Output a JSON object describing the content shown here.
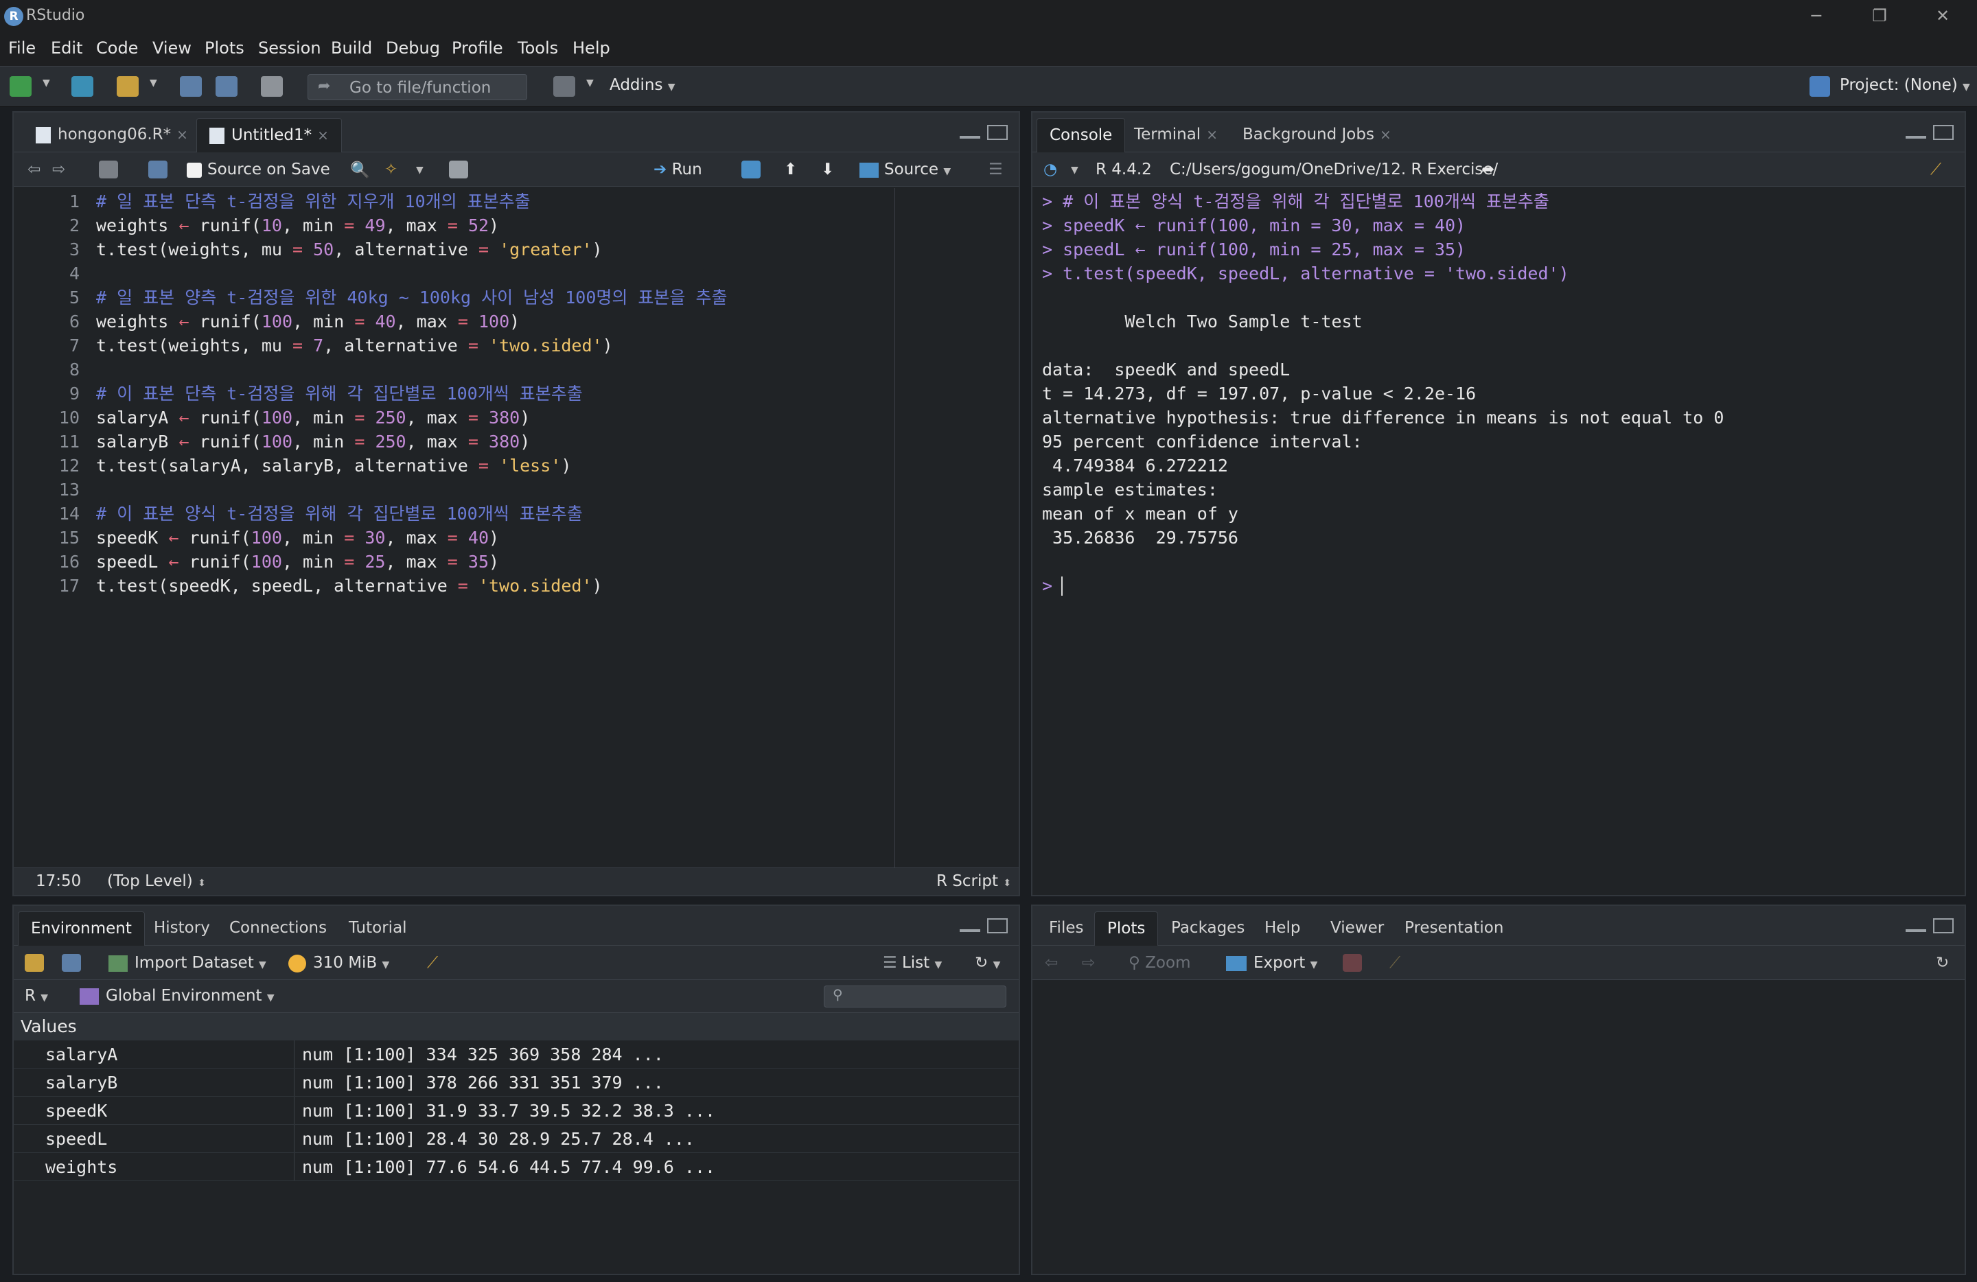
{
  "app": {
    "logo_letter": "R",
    "title": "RStudio"
  },
  "window_controls": {
    "minimize": "─",
    "restore": "❐",
    "close": "✕"
  },
  "menu": [
    "File",
    "Edit",
    "Code",
    "View",
    "Plots",
    "Session",
    "Build",
    "Debug",
    "Profile",
    "Tools",
    "Help"
  ],
  "toolbar": {
    "goto_placeholder": "Go to file/function",
    "addins_label": "Addins",
    "project_label": "Project: (None)"
  },
  "source_pane": {
    "tabs": [
      {
        "label": "hongong06.R*",
        "close": "×"
      },
      {
        "label": "Untitled1*",
        "close": "×"
      }
    ],
    "source_on_save_label": "Source on Save",
    "run_label": "Run",
    "source_label": "Source",
    "code_lines": [
      {
        "n": "1",
        "tokens": [
          [
            "c",
            "# 일 표본 단측 t-검정을 위한 지우개 10개의 표본추출"
          ]
        ]
      },
      {
        "n": "2",
        "tokens": [
          [
            "p",
            "weights "
          ],
          [
            "o",
            "←"
          ],
          [
            "p",
            " runif("
          ],
          [
            "d",
            "10"
          ],
          [
            "p",
            ", min "
          ],
          [
            "o",
            "="
          ],
          [
            "p",
            " "
          ],
          [
            "d",
            "49"
          ],
          [
            "p",
            ", max "
          ],
          [
            "o",
            "="
          ],
          [
            "p",
            " "
          ],
          [
            "d",
            "52"
          ],
          [
            "p",
            ")"
          ]
        ]
      },
      {
        "n": "3",
        "tokens": [
          [
            "p",
            "t.test(weights, mu "
          ],
          [
            "o",
            "="
          ],
          [
            "p",
            " "
          ],
          [
            "d",
            "50"
          ],
          [
            "p",
            ", alternative "
          ],
          [
            "o",
            "="
          ],
          [
            "p",
            " "
          ],
          [
            "s",
            "'greater'"
          ],
          [
            "p",
            ")"
          ]
        ]
      },
      {
        "n": "4",
        "tokens": []
      },
      {
        "n": "5",
        "tokens": [
          [
            "c",
            "# 일 표본 양측 t-검정을 위한 40kg ~ 100kg 사이 남성 100명의 표본을 추출"
          ]
        ]
      },
      {
        "n": "6",
        "tokens": [
          [
            "p",
            "weights "
          ],
          [
            "o",
            "←"
          ],
          [
            "p",
            " runif("
          ],
          [
            "d",
            "100"
          ],
          [
            "p",
            ", min "
          ],
          [
            "o",
            "="
          ],
          [
            "p",
            " "
          ],
          [
            "d",
            "40"
          ],
          [
            "p",
            ", max "
          ],
          [
            "o",
            "="
          ],
          [
            "p",
            " "
          ],
          [
            "d",
            "100"
          ],
          [
            "p",
            ")"
          ]
        ]
      },
      {
        "n": "7",
        "tokens": [
          [
            "p",
            "t.test(weights, mu "
          ],
          [
            "o",
            "="
          ],
          [
            "p",
            " "
          ],
          [
            "d",
            "7"
          ],
          [
            "p",
            ", alternative "
          ],
          [
            "o",
            "="
          ],
          [
            "p",
            " "
          ],
          [
            "s",
            "'two.sided'"
          ],
          [
            "p",
            ")"
          ]
        ]
      },
      {
        "n": "8",
        "tokens": []
      },
      {
        "n": "9",
        "tokens": [
          [
            "c",
            "# 이 표본 단측 t-검정을 위해 각 집단별로 100개씩 표본추출"
          ]
        ]
      },
      {
        "n": "10",
        "tokens": [
          [
            "p",
            "salaryA "
          ],
          [
            "o",
            "←"
          ],
          [
            "p",
            " runif("
          ],
          [
            "d",
            "100"
          ],
          [
            "p",
            ", min "
          ],
          [
            "o",
            "="
          ],
          [
            "p",
            " "
          ],
          [
            "d",
            "250"
          ],
          [
            "p",
            ", max "
          ],
          [
            "o",
            "="
          ],
          [
            "p",
            " "
          ],
          [
            "d",
            "380"
          ],
          [
            "p",
            ")"
          ]
        ]
      },
      {
        "n": "11",
        "tokens": [
          [
            "p",
            "salaryB "
          ],
          [
            "o",
            "←"
          ],
          [
            "p",
            " runif("
          ],
          [
            "d",
            "100"
          ],
          [
            "p",
            ", min "
          ],
          [
            "o",
            "="
          ],
          [
            "p",
            " "
          ],
          [
            "d",
            "250"
          ],
          [
            "p",
            ", max "
          ],
          [
            "o",
            "="
          ],
          [
            "p",
            " "
          ],
          [
            "d",
            "380"
          ],
          [
            "p",
            ")"
          ]
        ]
      },
      {
        "n": "12",
        "tokens": [
          [
            "p",
            "t.test(salaryA, salaryB, alternative "
          ],
          [
            "o",
            "="
          ],
          [
            "p",
            " "
          ],
          [
            "s",
            "'less'"
          ],
          [
            "p",
            ")"
          ]
        ]
      },
      {
        "n": "13",
        "tokens": []
      },
      {
        "n": "14",
        "tokens": [
          [
            "c",
            "# 이 표본 양식 t-검정을 위해 각 집단별로 100개씩 표본추출"
          ]
        ]
      },
      {
        "n": "15",
        "tokens": [
          [
            "p",
            "speedK "
          ],
          [
            "o",
            "←"
          ],
          [
            "p",
            " runif("
          ],
          [
            "d",
            "100"
          ],
          [
            "p",
            ", min "
          ],
          [
            "o",
            "="
          ],
          [
            "p",
            " "
          ],
          [
            "d",
            "30"
          ],
          [
            "p",
            ", max "
          ],
          [
            "o",
            "="
          ],
          [
            "p",
            " "
          ],
          [
            "d",
            "40"
          ],
          [
            "p",
            ")"
          ]
        ]
      },
      {
        "n": "16",
        "tokens": [
          [
            "p",
            "speedL "
          ],
          [
            "o",
            "←"
          ],
          [
            "p",
            " runif("
          ],
          [
            "d",
            "100"
          ],
          [
            "p",
            ", min "
          ],
          [
            "o",
            "="
          ],
          [
            "p",
            " "
          ],
          [
            "d",
            "25"
          ],
          [
            "p",
            ", max "
          ],
          [
            "o",
            "="
          ],
          [
            "p",
            " "
          ],
          [
            "d",
            "35"
          ],
          [
            "p",
            ")"
          ]
        ]
      },
      {
        "n": "17",
        "tokens": [
          [
            "p",
            "t.test(speedK, speedL, alternative "
          ],
          [
            "o",
            "="
          ],
          [
            "p",
            " "
          ],
          [
            "s",
            "'two.sided'"
          ],
          [
            "p",
            ")"
          ]
        ]
      }
    ],
    "status": {
      "position": "17:50",
      "scope": "(Top Level)",
      "filetype": "R Script"
    }
  },
  "console_pane": {
    "tabs": [
      {
        "label": "Console",
        "close": ""
      },
      {
        "label": "Terminal",
        "close": "×"
      },
      {
        "label": "Background Jobs",
        "close": "×"
      }
    ],
    "r_version": "R 4.4.2",
    "working_dir": "C:/Users/gogum/OneDrive/12. R Exercise/",
    "lines": [
      {
        "kind": "cmd",
        "text": "> # 이 표본 양식 t-검정을 위해 각 집단별로 100개씩 표본추출"
      },
      {
        "kind": "cmd",
        "text": "> speedK ← runif(100, min = 30, max = 40)"
      },
      {
        "kind": "cmd",
        "text": "> speedL ← runif(100, min = 25, max = 35)"
      },
      {
        "kind": "cmd",
        "text": "> t.test(speedK, speedL, alternative = 'two.sided')"
      },
      {
        "kind": "out",
        "text": ""
      },
      {
        "kind": "out",
        "text": "\tWelch Two Sample t-test"
      },
      {
        "kind": "out",
        "text": ""
      },
      {
        "kind": "out",
        "text": "data:  speedK and speedL"
      },
      {
        "kind": "out",
        "text": "t = 14.273, df = 197.07, p-value < 2.2e-16"
      },
      {
        "kind": "out",
        "text": "alternative hypothesis: true difference in means is not equal to 0"
      },
      {
        "kind": "out",
        "text": "95 percent confidence interval:"
      },
      {
        "kind": "out",
        "text": " 4.749384 6.272212"
      },
      {
        "kind": "out",
        "text": "sample estimates:"
      },
      {
        "kind": "out",
        "text": "mean of x mean of y "
      },
      {
        "kind": "out",
        "text": " 35.26836  29.75756 "
      },
      {
        "kind": "out",
        "text": ""
      },
      {
        "kind": "cmd",
        "text": "> "
      }
    ]
  },
  "env_pane": {
    "tabs": [
      "Environment",
      "History",
      "Connections",
      "Tutorial"
    ],
    "import_dataset_label": "Import Dataset",
    "memory_label": "310 MiB",
    "view_mode_label": "List",
    "language_label": "R",
    "scope_label": "Global Environment",
    "section_header": "Values",
    "rows": [
      {
        "name": "salaryA",
        "value": "num [1:100] 334 325 369 358 284 ..."
      },
      {
        "name": "salaryB",
        "value": "num [1:100] 378 266 331 351 379 ..."
      },
      {
        "name": "speedK",
        "value": "num [1:100] 31.9 33.7 39.5 32.2 38.3 ..."
      },
      {
        "name": "speedL",
        "value": "num [1:100] 28.4 30 28.9 25.7 28.4 ..."
      },
      {
        "name": "weights",
        "value": "num [1:100] 77.6 54.6 44.5 77.4 99.6 ..."
      }
    ]
  },
  "files_pane": {
    "tabs": [
      "Files",
      "Plots",
      "Packages",
      "Help",
      "Viewer",
      "Presentation"
    ],
    "active_tab": "Plots",
    "zoom_label": "Zoom",
    "export_label": "Export"
  }
}
